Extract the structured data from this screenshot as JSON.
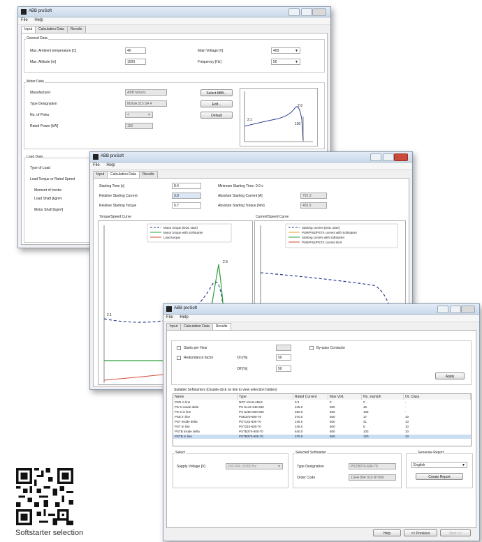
{
  "app": {
    "title": "ABB proSoft"
  },
  "menu": {
    "file": "File",
    "help": "Help"
  },
  "tabs": {
    "input": "Input",
    "calc": "Calculation Data",
    "results": "Results"
  },
  "win1": {
    "general_data": "General Data",
    "max_ambient_label": "Max. Ambient temperature [C]",
    "max_ambient_value": "40",
    "max_altitude_label": "Max. Altitude [m]",
    "max_altitude_value": "1000",
    "main_voltage_label": "Main Voltage [V]",
    "main_voltage_value": "400",
    "frequency_label": "Frequency [Hz]",
    "frequency_value": "50",
    "motor_data": "Motor Data",
    "manufacturer_label": "Manufacturer",
    "manufacturer_value": "ABB Motors",
    "type_label": "Type Designation",
    "type_value": "M3GA 315 SA 4",
    "poles_label": "No. of Poles",
    "poles_value": "4",
    "rated_power_label": "Rated Power [kW]",
    "rated_power_value": "160",
    "select_abb": "Select ABB...",
    "edit": "Edit...",
    "default": "Default",
    "chart_label_21": "2.1",
    "chart_label_29": "2.9",
    "chart_label_100": "100",
    "load_data": "Load Data",
    "type_of_load": "Type of Load",
    "load_torque": "Load Torque or Rated Speed",
    "moment_inertia": "Moment of Inertia",
    "load_shaft": "Load Shaft [kgm²]",
    "motor_shaft": "Motor Shaft [kgm²]"
  },
  "win2": {
    "starting_time_label": "Starting Time [s]",
    "starting_time_value": "8.4",
    "rel_start_current_label": "Relative Starting Current",
    "rel_start_current_value": "3.0",
    "rel_start_torque_label": "Relative Starting Torque",
    "rel_start_torque_value": "0.7",
    "min_start_time_label": "Minimum Starting Time: 0.0 s",
    "abs_start_current_label": "Absolute Starting Current [A]",
    "abs_start_current_value": "792.3",
    "abs_start_torque_label": "Absolute Starting Torque [Nm]",
    "abs_start_torque_value": "483.9",
    "torque_speed_title": "Torque/Speed Curve",
    "current_speed_title": "Current/Speed Curve",
    "torque_legend": [
      "Motor torque (DOL start)",
      "Motor torque with Softstarter",
      "Load torque"
    ],
    "current_legend": [
      "Starting current (DOL start)",
      "PSR/PSE/PSTX current with Softstarter",
      "Starting current with softstarter",
      "PSR/PSE/PSTX current limit"
    ],
    "label_29": "2.9",
    "label_21": "2.1"
  },
  "win3": {
    "bypass_label": "Starts per Hour",
    "redundancy_label": "Redundance factor",
    "on_label": "On [%]",
    "on_value": "50",
    "off_label": "Off [%]",
    "off_value": "50",
    "bypass_contactor": "By-pass Contactor",
    "apply": "Apply",
    "suitable_label": "Suitable Softstarters (Double-click on line to view selection hidden)",
    "columns": [
      "Name",
      "Type",
      "Rated Current",
      "Max Volt.",
      "No. starts/h",
      "OL Class"
    ],
    "rows": [
      [
        "PSR in line",
        "NOT AVAILABLE",
        "0.0",
        "0",
        "0",
        "-"
      ],
      [
        "PS S inside delta",
        "PS S142-245-500",
        "245.0",
        "500",
        "45",
        "-"
      ],
      [
        "PS S in line",
        "PS S260-600-500",
        "260.0",
        "600",
        "105",
        "-"
      ],
      [
        "PSE in line",
        "PSE370-600-70",
        "370.0",
        "600",
        "17",
        "10"
      ],
      [
        "PST inside delta",
        "PST142-600-70",
        "245.0",
        "600",
        "41",
        "10"
      ],
      [
        "PST in line",
        "PST210-600-70",
        "245.0",
        "600",
        "5",
        "10"
      ],
      [
        "PSTB inside delta",
        "PSTB370-600-70",
        "640.0",
        "600",
        "103",
        "10"
      ],
      [
        "PSTB in line",
        "PSTB370-600-70",
        "370.0",
        "600",
        "120",
        "10"
      ]
    ],
    "select_group": "Select",
    "supply_voltage_label": "Supply Voltage [V]",
    "supply_voltage_value": "220-690, 50/60 Hz",
    "selected_group": "Selected Softstarter",
    "type_designation_label": "Type Designation",
    "type_designation_value": "PSTB370-600-70",
    "order_code_label": "Order Code",
    "order_code_value": "1SFA 894 010 R7000",
    "report_group": "Generate Report",
    "language_value": "English",
    "create_report": "Create Report",
    "help": "Help",
    "previous": "<< Previous",
    "next": "Next >>"
  },
  "caption": "Softstarter selection"
}
